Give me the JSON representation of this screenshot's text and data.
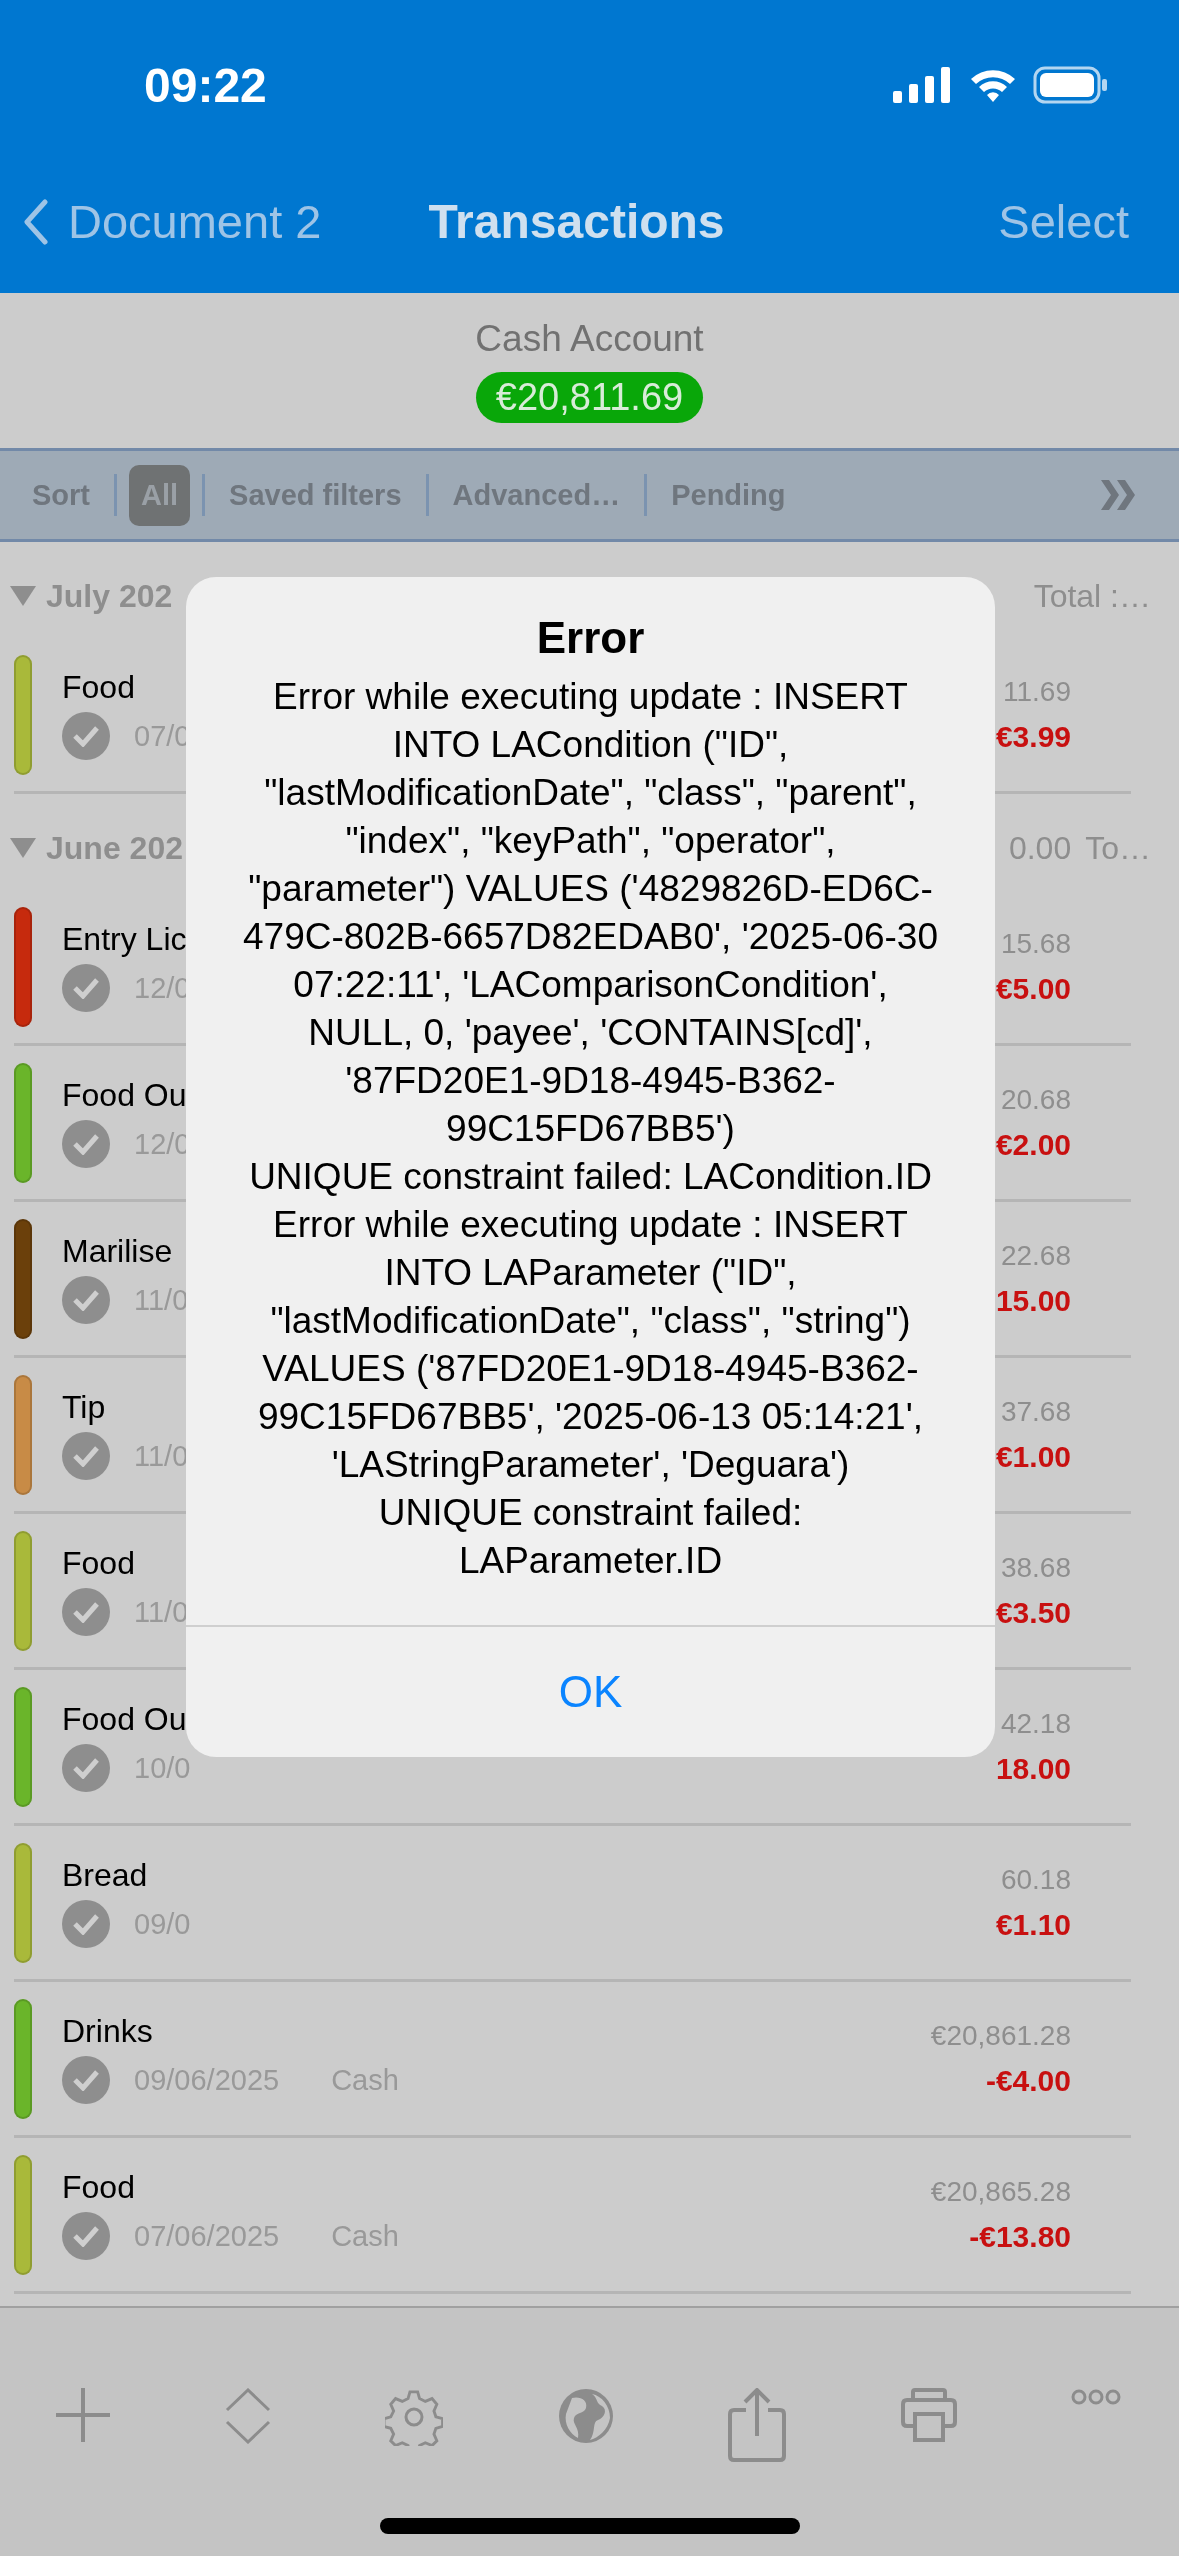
{
  "status_bar": {
    "time": "09:22"
  },
  "nav": {
    "back": "Document 2",
    "title": "Transactions",
    "action": "Select"
  },
  "account": {
    "name": "Cash Account",
    "balance": "€20,811.69"
  },
  "filters": [
    {
      "label": "Sort",
      "selected": false
    },
    {
      "label": "All",
      "selected": true
    },
    {
      "label": "Saved filters",
      "selected": false
    },
    {
      "label": "Advanced…",
      "selected": false
    },
    {
      "label": "Pending",
      "selected": false
    }
  ],
  "sections": [
    {
      "title": "July 202",
      "total": "Total :…",
      "expanded": true,
      "rows": [
        {
          "name": "Food",
          "date": "07/0",
          "balance": "11.69",
          "amount": "€3.99",
          "color": "#a9b93a",
          "cleared": true
        }
      ]
    },
    {
      "title": "June 202",
      "total_amount": "0.00",
      "total": "To…",
      "expanded": true,
      "rows": [
        {
          "name": "Entry Lic",
          "date": "12/0",
          "balance": "15.68",
          "amount": "€5.00",
          "color": "#c62a0d",
          "cleared": true
        },
        {
          "name": "Food Ou",
          "date": "12/0",
          "balance": "20.68",
          "amount": "€2.00",
          "color": "#6ab52a",
          "cleared": true
        },
        {
          "name": "Marilise",
          "date": "11/0",
          "balance": "22.68",
          "amount": "15.00",
          "color": "#6b400b",
          "cleared": true
        },
        {
          "name": "Tip",
          "date": "11/0",
          "balance": "37.68",
          "amount": "€1.00",
          "color": "#c88b46",
          "cleared": true
        },
        {
          "name": "Food",
          "date": "11/0",
          "balance": "38.68",
          "amount": "€3.50",
          "color": "#a9b93a",
          "cleared": true
        },
        {
          "name": "Food Ou",
          "date": "10/0",
          "balance": "42.18",
          "amount": "18.00",
          "color": "#6ab52a",
          "cleared": true
        },
        {
          "name": "Bread",
          "date": "09/0",
          "balance": "60.18",
          "amount": "€1.10",
          "color": "#a9b93a",
          "cleared": true
        },
        {
          "name": "Drinks",
          "date": "09/06/2025",
          "account": "Cash",
          "balance": "€20,861.28",
          "amount": "-€4.00",
          "color": "#6ab52a",
          "cleared": true
        },
        {
          "name": "Food",
          "date": "07/06/2025",
          "account": "Cash",
          "balance": "€20,865.28",
          "amount": "-€13.80",
          "color": "#a9b93a",
          "cleared": true
        }
      ]
    }
  ],
  "dialog": {
    "title": "Error",
    "message": "Error while executing update : INSERT INTO LACondition (\"ID\", \"lastModificationDate\", \"class\", \"parent\", \"index\", \"keyPath\", \"operator\", \"parameter\") VALUES ('4829826D-ED6C-479C-802B-6657D82EDAB0', '2025-06-30 07:22:11', 'LAComparisonCondition', NULL, 0, 'payee', 'CONTAINS[cd]', '87FD20E1-9D18-4945-B362-99C15FD67BB5')\nUNIQUE constraint failed: LACondition.ID\nError while executing update : INSERT INTO LAParameter (\"ID\", \"lastModificationDate\", \"class\", \"string\") VALUES ('87FD20E1-9D18-4945-B362-99C15FD67BB5', '2025-06-13 05:14:21', 'LAStringParameter', 'Deguara')\nUNIQUE constraint failed: LAParameter.ID",
    "button": "OK"
  }
}
